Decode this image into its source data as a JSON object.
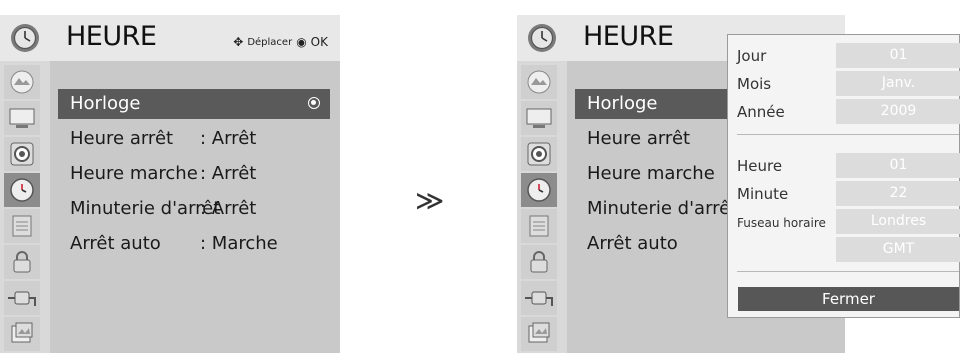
{
  "left_panel": {
    "header": {
      "title": "HEURE",
      "hint_move": "Déplacer",
      "hint_ok": "OK"
    },
    "icons": [
      "picture-icon",
      "screen-icon",
      "audio-icon",
      "clock-icon",
      "options-icon",
      "lock-icon",
      "input-icon",
      "photo-icon"
    ],
    "active_icon_index": 3,
    "menu": [
      {
        "label": "Horloge",
        "value": ""
      },
      {
        "label": "Heure arrêt",
        "value": ": Arrêt"
      },
      {
        "label": "Heure marche",
        "value": ": Arrêt"
      },
      {
        "label": "Minuterie d'arrêt",
        "value": ": Arrêt"
      },
      {
        "label": "Arrêt auto",
        "value": ": Marche"
      }
    ]
  },
  "arrow": "≫",
  "right_panel": {
    "header": {
      "title": "HEURE"
    },
    "menu": [
      "Horloge",
      "Heure arrêt",
      "Heure marche",
      "Minuterie d'arrêt",
      "Arrêt auto"
    ],
    "popup": {
      "fields": [
        {
          "label": "Jour",
          "value": "01"
        },
        {
          "label": "Mois",
          "value": "Janv."
        },
        {
          "label": "Année",
          "value": "2009"
        },
        {
          "label": "Heure",
          "value": "01"
        },
        {
          "label": "Minute",
          "value": "22"
        },
        {
          "label": "Fuseau horaire",
          "value": "Londres"
        },
        {
          "label": "",
          "value": "GMT"
        }
      ],
      "close_label": "Fermer"
    }
  },
  "colors": {
    "panel": "#c9c9c9",
    "header": "#e8e8e8",
    "selected": "#5a5a5a",
    "popup": "#f4f4f4"
  }
}
